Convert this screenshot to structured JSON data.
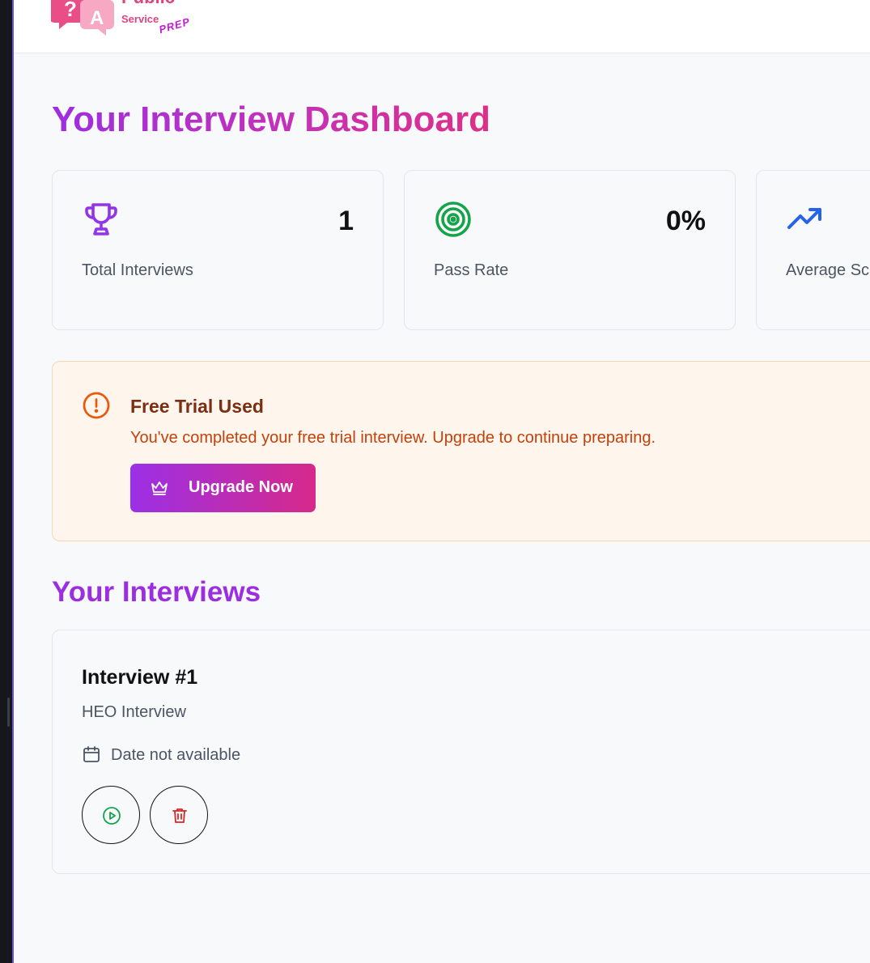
{
  "brand": {
    "word": "Public",
    "sub": "Service",
    "tag": "PREP",
    "colors": {
      "pink": "#e0447f",
      "purple": "#c41ad8"
    }
  },
  "dashboard": {
    "title": "Your Interview Dashboard"
  },
  "stats": [
    {
      "icon": "trophy-icon",
      "value": "1",
      "label": "Total Interviews",
      "color": "#9333ea"
    },
    {
      "icon": "target-icon",
      "value": "0%",
      "label": "Pass Rate",
      "color": "#16a34a"
    },
    {
      "icon": "trending-up-icon",
      "value": "",
      "label": "Average Sc",
      "color": "#2563eb"
    }
  ],
  "trial": {
    "icon": "alert-circle-icon",
    "title": "Free Trial Used",
    "message": "You've completed your free trial interview. Upgrade to continue preparing.",
    "button_label": "Upgrade Now",
    "button_icon": "crown-icon"
  },
  "interviews": {
    "title": "Your Interviews",
    "items": [
      {
        "title": "Interview #1",
        "type": "HEO Interview",
        "date": "Date not available",
        "actions": [
          "play-icon",
          "trash-icon"
        ]
      }
    ]
  }
}
